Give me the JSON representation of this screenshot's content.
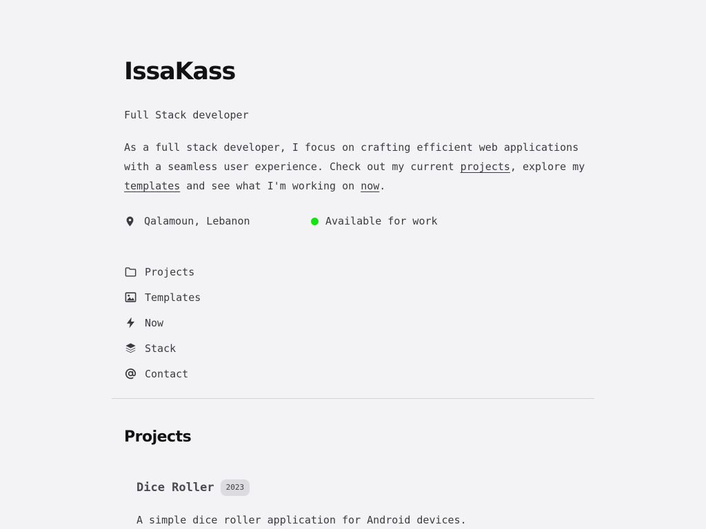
{
  "header": {
    "name": "IssaKass",
    "role": "Full Stack developer"
  },
  "bio": {
    "text_1": "As a full stack developer, I focus on crafting efficient web applications with a seamless user experience. Check out my current ",
    "link_projects": "projects",
    "text_2": ", explore my ",
    "link_templates": "templates",
    "text_3": " and see what I'm working on ",
    "link_now": "now",
    "text_4": "."
  },
  "meta": {
    "location": "Qalamoun, Lebanon",
    "location_icon": "map-pin-icon",
    "availability": "Available for work",
    "availability_color": "#13e313"
  },
  "nav": {
    "items": [
      {
        "label": "Projects",
        "icon": "folder-icon"
      },
      {
        "label": "Templates",
        "icon": "image-icon"
      },
      {
        "label": "Now",
        "icon": "bolt-icon"
      },
      {
        "label": "Stack",
        "icon": "layers-icon"
      },
      {
        "label": "Contact",
        "icon": "at-sign-icon"
      }
    ]
  },
  "projects_section": {
    "title": "Projects",
    "items": [
      {
        "name": "Dice Roller",
        "year": "2023",
        "description": "A simple dice roller application for Android devices."
      }
    ]
  }
}
